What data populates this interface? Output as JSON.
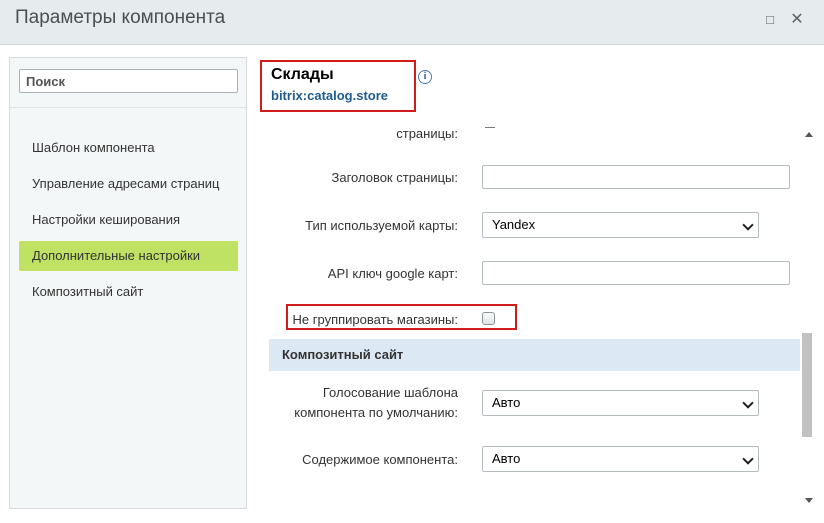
{
  "window": {
    "title": "Параметры компонента"
  },
  "sidebar": {
    "search_placeholder": "Поиск",
    "items": [
      {
        "label": "Шаблон компонента",
        "active": false
      },
      {
        "label": "Управление адресами страниц",
        "active": false
      },
      {
        "label": "Настройки кеширования",
        "active": false
      },
      {
        "label": "Дополнительные настройки",
        "active": true
      },
      {
        "label": "Композитный сайт",
        "active": false
      }
    ]
  },
  "component": {
    "name": "Склады",
    "code": "bitrix:catalog.store",
    "info_icon": "i"
  },
  "form": {
    "partial_label": "страницы:",
    "page_title_label": "Заголовок страницы:",
    "page_title_value": "",
    "map_type_label": "Тип используемой карты:",
    "map_type_value": "Yandex",
    "google_key_label": "API ключ google карт:",
    "google_key_value": "",
    "no_group_label": "Не группировать магазины:",
    "no_group_checked": false,
    "section_composite": "Композитный сайт",
    "vote_label_line1": "Голосование шаблона",
    "vote_label_line2": "компонента по умолчанию:",
    "vote_value": "Авто",
    "content_label": "Содержимое компонента:",
    "content_value": "Авто"
  },
  "colors": {
    "active_item": "#bfe164",
    "highlight": "#d11a1a",
    "section_bg": "#dce9f4",
    "link": "#1f5c8f"
  }
}
